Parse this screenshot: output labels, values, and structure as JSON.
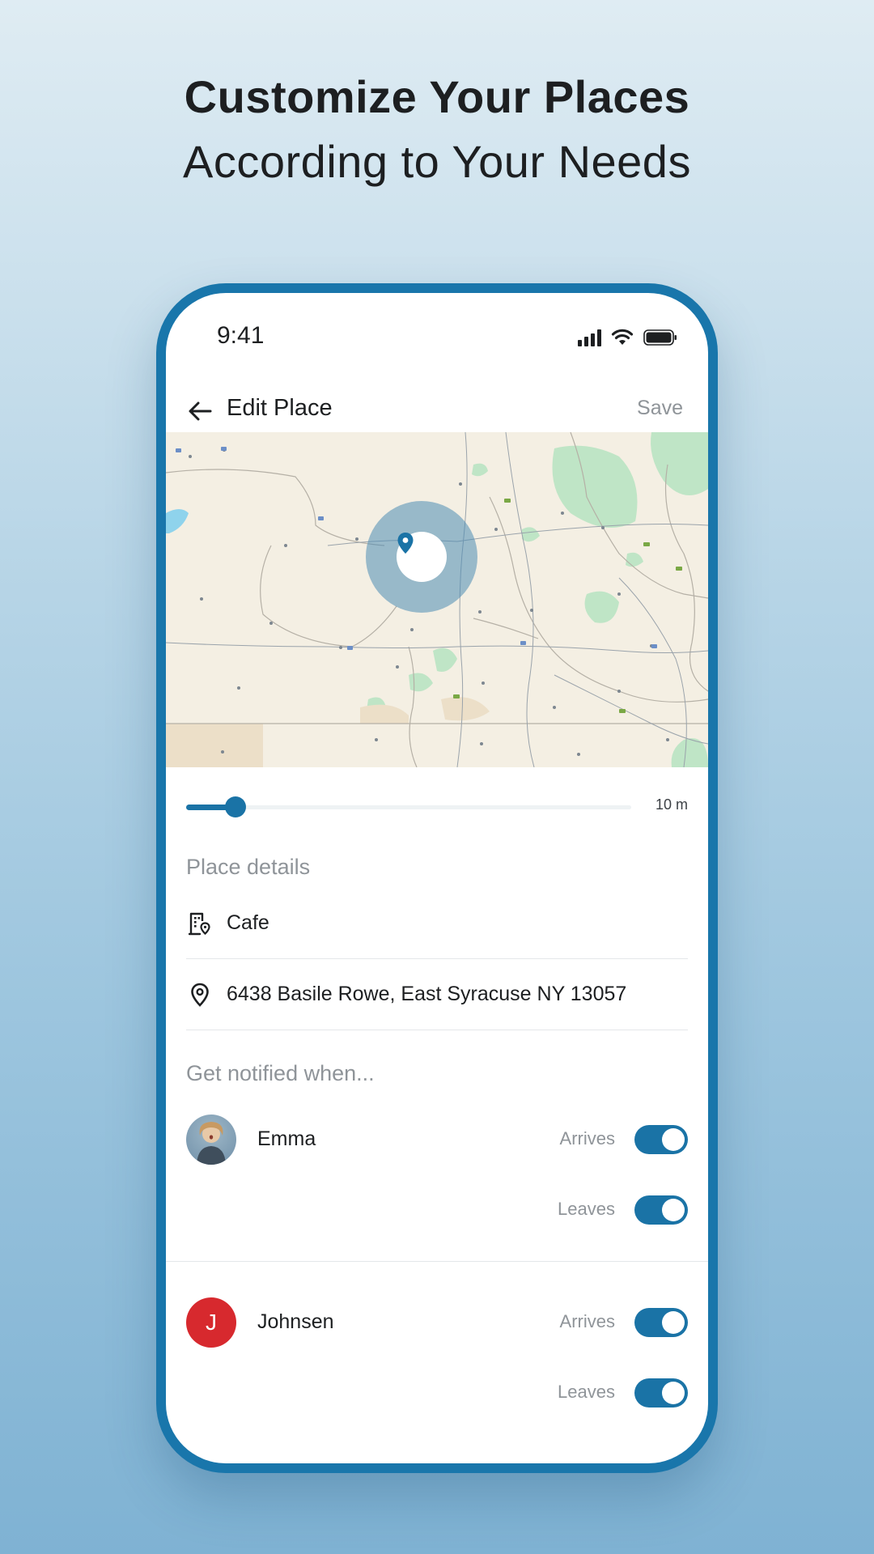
{
  "promo": {
    "headline_bold": "Customize Your Places",
    "headline_regular": "According to Your Needs"
  },
  "status_bar": {
    "time": "9:41",
    "icons": [
      "cellular-signal-icon",
      "wifi-icon",
      "battery-icon"
    ]
  },
  "header": {
    "back_icon": "arrow-left-icon",
    "title": "Edit Place",
    "save_label": "Save"
  },
  "map": {
    "pin_icon": "map-pin-icon"
  },
  "radius_slider": {
    "value_fraction": 0.11,
    "value_label": "10 m"
  },
  "place_details": {
    "section_label": "Place details",
    "name": {
      "icon": "building-pin-icon",
      "value": "Cafe"
    },
    "address": {
      "icon": "location-pin-icon",
      "value": "6438 Basile Rowe, East Syracuse NY 13057"
    }
  },
  "notifications": {
    "section_label": "Get notified when...",
    "people": [
      {
        "name": "Emma",
        "avatar": "photo",
        "arrives": {
          "label": "Arrives",
          "enabled": true
        },
        "leaves": {
          "label": "Leaves",
          "enabled": true
        }
      },
      {
        "name": "Johnsen",
        "avatar_initial": "J",
        "arrives": {
          "label": "Arrives",
          "enabled": true
        },
        "leaves": {
          "label": "Leaves",
          "enabled": true
        }
      }
    ]
  },
  "colors": {
    "accent": "#1a73a6",
    "phone_frame": "#1976ab",
    "avatar_red": "#d7292e",
    "muted_text": "#8f9499"
  }
}
